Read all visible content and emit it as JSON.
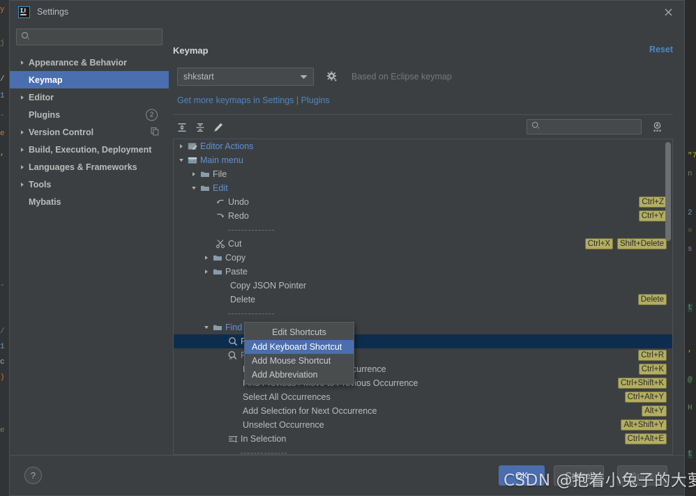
{
  "window": {
    "title": "Settings",
    "logo_icon": "intellij-idea-logo",
    "close_icon": "close-icon"
  },
  "sidebar": {
    "search": {
      "placeholder": "",
      "value": "",
      "icon": "search-icon"
    },
    "items": [
      {
        "label": "Appearance & Behavior",
        "expandable": true,
        "selected": false
      },
      {
        "label": "Keymap",
        "expandable": false,
        "selected": true
      },
      {
        "label": "Editor",
        "expandable": true,
        "selected": false
      },
      {
        "label": "Plugins",
        "expandable": false,
        "selected": false,
        "badge": "2"
      },
      {
        "label": "Version Control",
        "expandable": true,
        "selected": false,
        "right_icon": "copy-icon"
      },
      {
        "label": "Build, Execution, Deployment",
        "expandable": true,
        "selected": false
      },
      {
        "label": "Languages & Frameworks",
        "expandable": true,
        "selected": false
      },
      {
        "label": "Tools",
        "expandable": true,
        "selected": false
      },
      {
        "label": "Mybatis",
        "expandable": false,
        "selected": false
      }
    ]
  },
  "pane": {
    "title": "Keymap",
    "reset_label": "Reset",
    "keymap_value": "shkstart",
    "gear_icon": "gear-icon",
    "based_on": "Based on Eclipse keymap",
    "get_more_link": "Get more keymaps in Settings | Plugins",
    "toolbar": {
      "expand_all": "expand-all-icon",
      "collapse_all": "collapse-all-icon",
      "edit": "pencil-edit-icon"
    },
    "tree_search": {
      "placeholder": "",
      "value": "",
      "icon": "search-icon"
    },
    "find_by_shortcut_icon": "find-by-shortcut-icon"
  },
  "tree": {
    "rows": [
      {
        "label": "Editor Actions",
        "indent": 0,
        "twist": "collapsed",
        "icon": "editor-actions-icon",
        "blue": true,
        "shortcuts": []
      },
      {
        "label": "Main menu",
        "indent": 0,
        "twist": "expanded",
        "icon": "main-menu-icon",
        "blue": true,
        "shortcuts": []
      },
      {
        "label": "File",
        "indent": 1,
        "twist": "collapsed",
        "icon": "folder-icon",
        "blue": false,
        "shortcuts": []
      },
      {
        "label": "Edit",
        "indent": 1,
        "twist": "expanded",
        "icon": "folder-icon",
        "blue": true,
        "shortcuts": []
      },
      {
        "label": "Undo",
        "indent": 2,
        "twist": "none",
        "icon": "undo-icon",
        "blue": false,
        "shortcuts": [
          "Ctrl+Z"
        ]
      },
      {
        "label": "Redo",
        "indent": 2,
        "twist": "none",
        "icon": "redo-icon",
        "blue": false,
        "shortcuts": [
          "Ctrl+Y"
        ]
      },
      {
        "separator": true,
        "indent": 2
      },
      {
        "label": "Cut",
        "indent": 2,
        "twist": "none",
        "icon": "scissors-icon",
        "blue": false,
        "shortcuts": [
          "Ctrl+X",
          "Shift+Delete"
        ]
      },
      {
        "label": "Copy",
        "indent": 2,
        "twist": "collapsed",
        "icon": "folder-icon",
        "blue": false,
        "shortcuts": []
      },
      {
        "label": "Paste",
        "indent": 2,
        "twist": "collapsed",
        "icon": "folder-icon",
        "blue": false,
        "shortcuts": []
      },
      {
        "label": "Copy JSON Pointer",
        "indent": 2,
        "twist": "none",
        "icon": "none",
        "blue": false,
        "shortcuts": []
      },
      {
        "label": "Delete",
        "indent": 2,
        "twist": "none",
        "icon": "none",
        "blue": false,
        "shortcuts": [
          "Delete"
        ]
      },
      {
        "separator": true,
        "indent": 2
      },
      {
        "label": "Find",
        "indent": 2,
        "twist": "expanded",
        "icon": "folder-icon",
        "blue": true,
        "shortcuts": []
      },
      {
        "label": "Find",
        "indent": 3,
        "twist": "none",
        "icon": "find-icon",
        "blue": false,
        "selected": true,
        "shortcuts": []
      },
      {
        "label": "Replace",
        "indent": 3,
        "twist": "none",
        "icon": "replace-icon",
        "blue": true,
        "shortcuts": [
          "Ctrl+R"
        ]
      },
      {
        "label": "Find Next / Move to Next Occurrence",
        "indent": 3,
        "twist": "none",
        "icon": "none",
        "blue": false,
        "shortcuts": [
          "Ctrl+K"
        ]
      },
      {
        "label": "Find Previous / Move to Previous Occurrence",
        "indent": 3,
        "twist": "none",
        "icon": "none",
        "blue": false,
        "shortcuts": [
          "Ctrl+Shift+K"
        ]
      },
      {
        "label": "Select All Occurrences",
        "indent": 3,
        "twist": "none",
        "icon": "none",
        "blue": false,
        "shortcuts": [
          "Ctrl+Alt+Y"
        ]
      },
      {
        "label": "Add Selection for Next Occurrence",
        "indent": 3,
        "twist": "none",
        "icon": "none",
        "blue": false,
        "shortcuts": [
          "Alt+Y"
        ]
      },
      {
        "label": "Unselect Occurrence",
        "indent": 3,
        "twist": "none",
        "icon": "none",
        "blue": false,
        "shortcuts": [
          "Alt+Shift+Y"
        ]
      },
      {
        "label": "In Selection",
        "indent": 3,
        "twist": "none",
        "icon": "in-selection-icon",
        "blue": false,
        "shortcuts": [
          "Ctrl+Alt+E"
        ]
      },
      {
        "separator": true,
        "indent": 3
      }
    ]
  },
  "context_menu": {
    "items": [
      {
        "label": "Edit Shortcuts",
        "header": true,
        "highlighted": false
      },
      {
        "label": "Add Keyboard Shortcut",
        "header": false,
        "highlighted": true
      },
      {
        "label": "Add Mouse Shortcut",
        "header": false,
        "highlighted": false
      },
      {
        "label": "Add Abbreviation",
        "header": false,
        "highlighted": false
      }
    ]
  },
  "footer": {
    "help_label": "?",
    "ok_label": "OK",
    "cancel_label": "Cancel",
    "apply_label": "Apply"
  },
  "watermark": {
    "text": "CSDN @抱着小兔子的大萝北"
  },
  "colors": {
    "dialog_bg": "#3c3f41",
    "selection_blue": "#4b6eaf",
    "tree_selection": "#0d2d4e",
    "link_blue": "#4a88c7",
    "tree_blue": "#5e93d8",
    "shortcut_badge": "#b3ae60",
    "text": "#bbbbbb"
  }
}
